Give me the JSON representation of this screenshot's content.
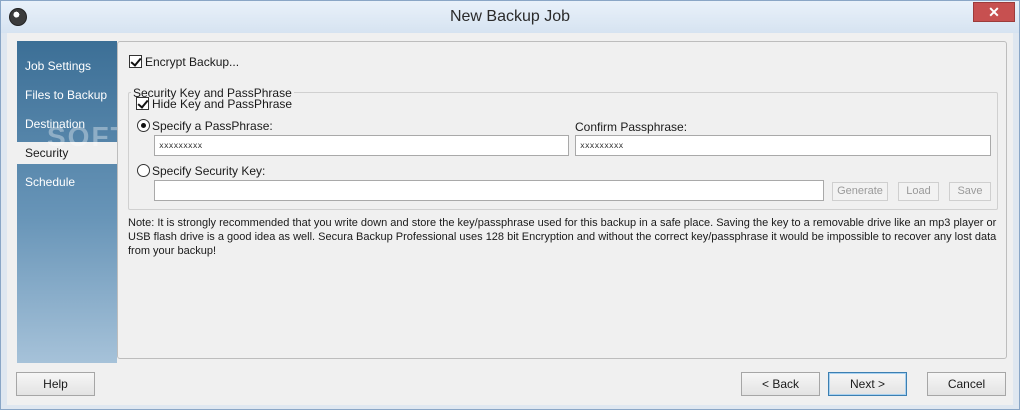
{
  "window": {
    "title": "New Backup Job",
    "close_glyph": "✕"
  },
  "sidebar": {
    "items": [
      {
        "label": "Job Settings"
      },
      {
        "label": "Files to Backup"
      },
      {
        "label": "Destination"
      },
      {
        "label": "Security"
      },
      {
        "label": "Schedule"
      }
    ],
    "active_index": 3
  },
  "security": {
    "encrypt_label": "Encrypt Backup...",
    "encrypt_checked": true,
    "group_title": "Security Key and PassPhrase",
    "hide_label": "Hide Key and PassPhrase",
    "hide_checked": true,
    "passphrase_label": "Specify a PassPhrase:",
    "passphrase_selected": true,
    "passphrase_value": "xxxxxxxxx",
    "confirm_label": "Confirm Passphrase:",
    "confirm_value": "xxxxxxxxx",
    "key_label": "Specify Security Key:",
    "key_value": "",
    "generate_label": "Generate",
    "load_label": "Load",
    "save_label": "Save",
    "note": "Note: It is strongly recommended that you write down and store the key/passphrase used for this backup in a safe place.  Saving the key to a removable drive like an mp3 player or USB flash drive is a good idea as well. Secura Backup Professional uses 128 bit Encryption and without the correct key/passphrase it would be impossible to recover any lost data from your backup!"
  },
  "footer": {
    "help_label": "Help",
    "back_label": "< Back",
    "next_label": "Next >",
    "cancel_label": "Cancel"
  },
  "watermark": "SOFTPEDIA"
}
